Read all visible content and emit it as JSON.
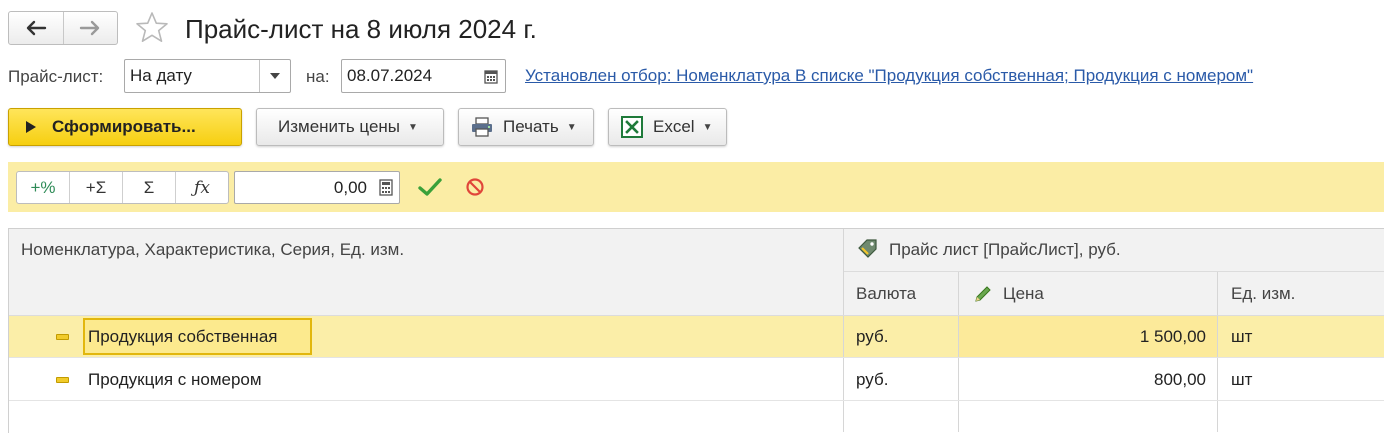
{
  "title": "Прайс-лист на 8 июля 2024 г.",
  "params": {
    "pricelist_label": "Прайс-лист:",
    "pricelist_mode": "На дату",
    "date_label": "на:",
    "date_value": "08.07.2024",
    "filter_text": "Установлен отбор: Номенклатура В списке \"Продукция собственная; Продукция с номером\""
  },
  "toolbar": {
    "generate_label": "Сформировать...",
    "change_prices_label": "Изменить цены",
    "print_label": "Печать",
    "excel_label": "Excel"
  },
  "edit_panel": {
    "ops": [
      "+%",
      "+Σ",
      "Σ",
      "ƒx"
    ],
    "value": "0,00"
  },
  "table": {
    "col_nomenclature": "Номенклатура, Характеристика, Серия, Ед. изм.",
    "group_header": "Прайс лист [ПрайсЛист], руб.",
    "col_currency": "Валюта",
    "col_price": "Цена",
    "col_unit": "Ед. изм.",
    "rows": [
      {
        "name": "Продукция собственная",
        "currency": "руб.",
        "price": "1 500,00",
        "unit": "шт"
      },
      {
        "name": "Продукция с номером",
        "currency": "руб.",
        "price": "800,00",
        "unit": "шт"
      }
    ]
  },
  "colors": {
    "accent_yellow": "#f6cf10",
    "panel_yellow": "#fbeda5",
    "link_blue": "#2a5aa8",
    "check_green": "#3aa13a",
    "cancel_red": "#e0463a"
  },
  "icons": [
    "back-arrow-icon",
    "forward-arrow-icon",
    "star-icon",
    "dropdown-icon",
    "calendar-icon",
    "play-icon",
    "printer-icon",
    "excel-icon",
    "calculator-icon",
    "check-icon",
    "cancel-icon",
    "price-tag-icon",
    "pencil-icon",
    "group-icon"
  ]
}
